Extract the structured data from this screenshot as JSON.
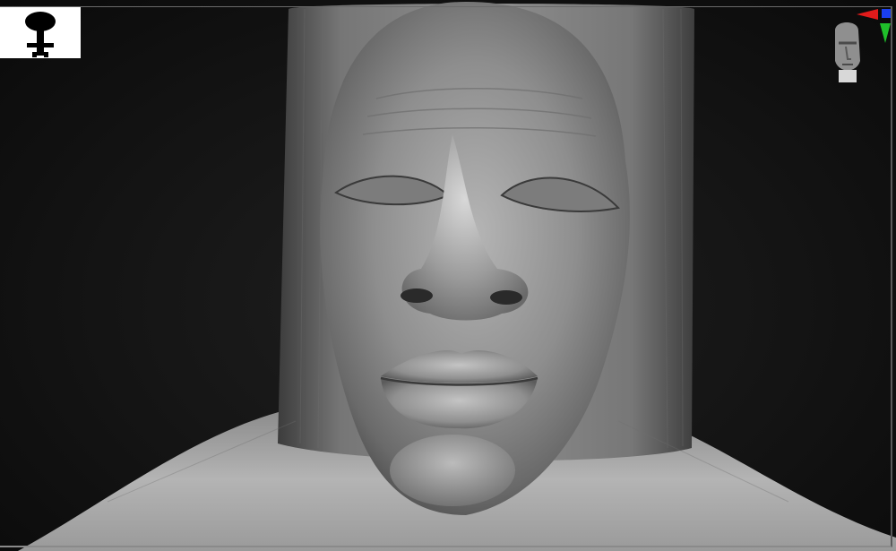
{
  "viewport": {
    "mode": "3d-sculpt-view",
    "background_color": "#141414",
    "mesh_material_color": "#9a9a9a"
  },
  "thumbnail": {
    "icon": "tool-silhouette-icon",
    "background_color": "#ffffff"
  },
  "navigator": {
    "icon": "head-navigator-icon",
    "axis_colors": {
      "x": "#e11b1b",
      "y": "#1fbf2a",
      "z": "#1a3ff0"
    }
  }
}
